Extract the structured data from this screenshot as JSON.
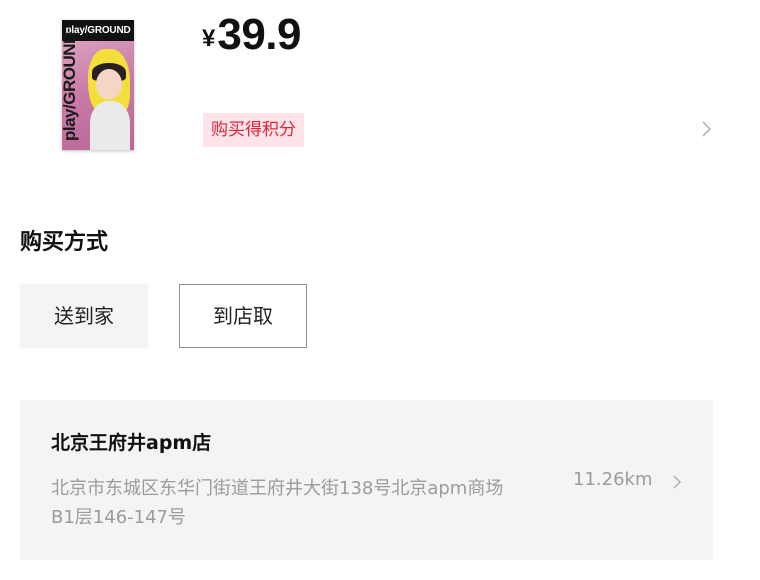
{
  "product": {
    "thumbnail_masthead": "play/GROUND",
    "thumbnail_spine": "play/GROUND",
    "currency_symbol": "¥",
    "price": "39.9",
    "points_badge": "购买得积分"
  },
  "purchase_method": {
    "title": "购买方式",
    "options": [
      {
        "label": "送到家",
        "selected": false
      },
      {
        "label": "到店取",
        "selected": true
      }
    ]
  },
  "store": {
    "name": "北京王府井apm店",
    "address": "北京市东城区东华门街道王府井大街138号北京apm商场B1层146-147号",
    "distance": "11.26km"
  },
  "icons": {
    "points_row": "chevron-right-icon",
    "store_row": "chevron-right-icon"
  },
  "colors": {
    "accent_red": "#e2243b",
    "badge_bg": "#fde4e8",
    "card_bg": "#f4f4f4",
    "muted_text": "#9b9b9b",
    "selected_border": "#8e8e8e"
  }
}
